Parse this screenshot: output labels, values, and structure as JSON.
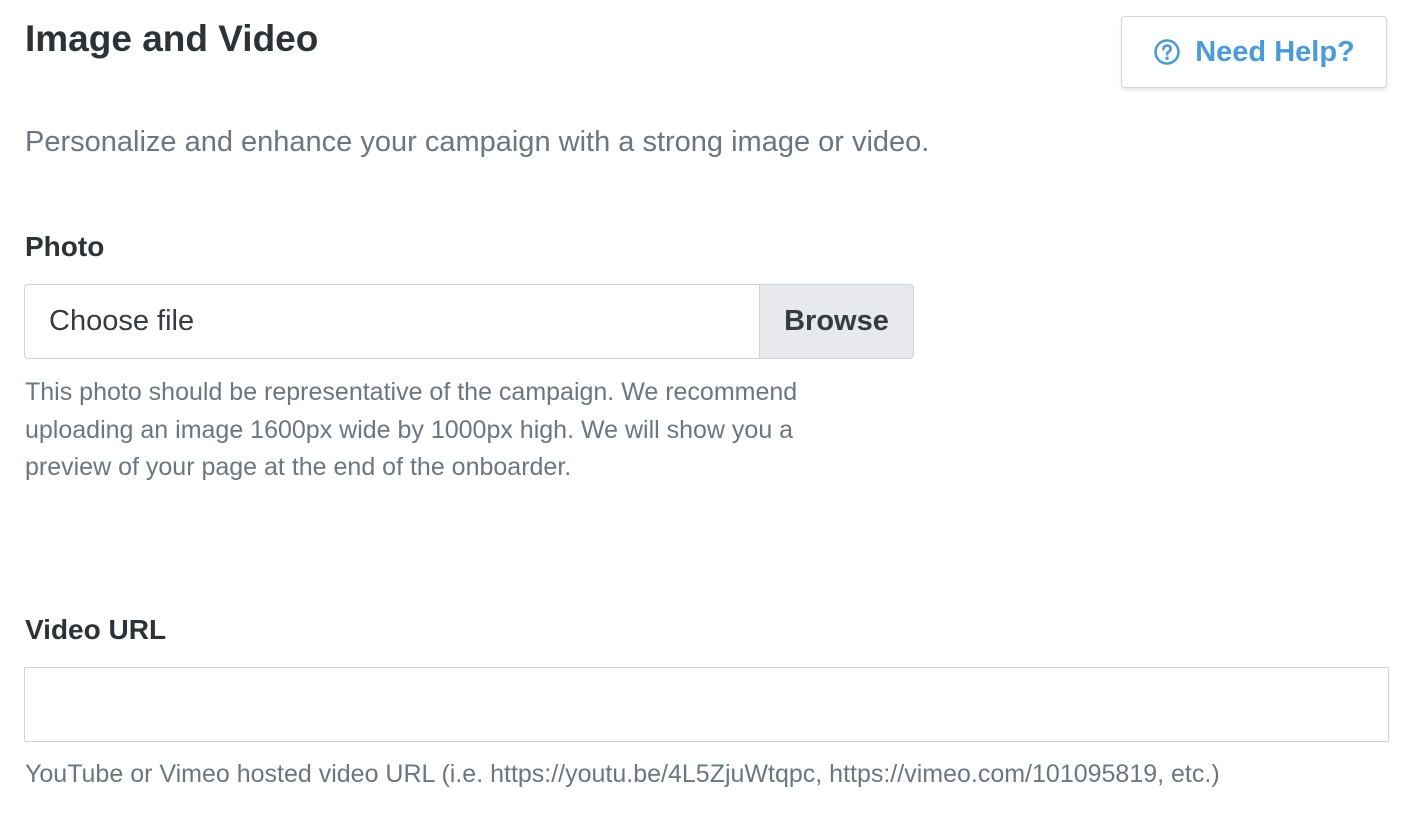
{
  "page": {
    "title": "Image and Video",
    "subtitle": "Personalize and enhance your campaign with a strong image or video."
  },
  "help_button": {
    "label": "Need Help?",
    "icon": "question-circle-icon",
    "color": "#4a9bd8"
  },
  "photo": {
    "label": "Photo",
    "file_placeholder": "Choose file",
    "browse_label": "Browse",
    "help_lines": [
      "This photo should be representative of the campaign. We recommend",
      "uploading an image 1600px wide by 1000px high. We will show you a",
      "preview of your page at the end of the onboarder."
    ]
  },
  "video": {
    "label": "Video URL",
    "value": "",
    "placeholder": "",
    "help": "YouTube or Vimeo hosted video URL (i.e. https://youtu.be/4L5ZjuWtqpc, https://vimeo.com/101095819, etc.)"
  }
}
